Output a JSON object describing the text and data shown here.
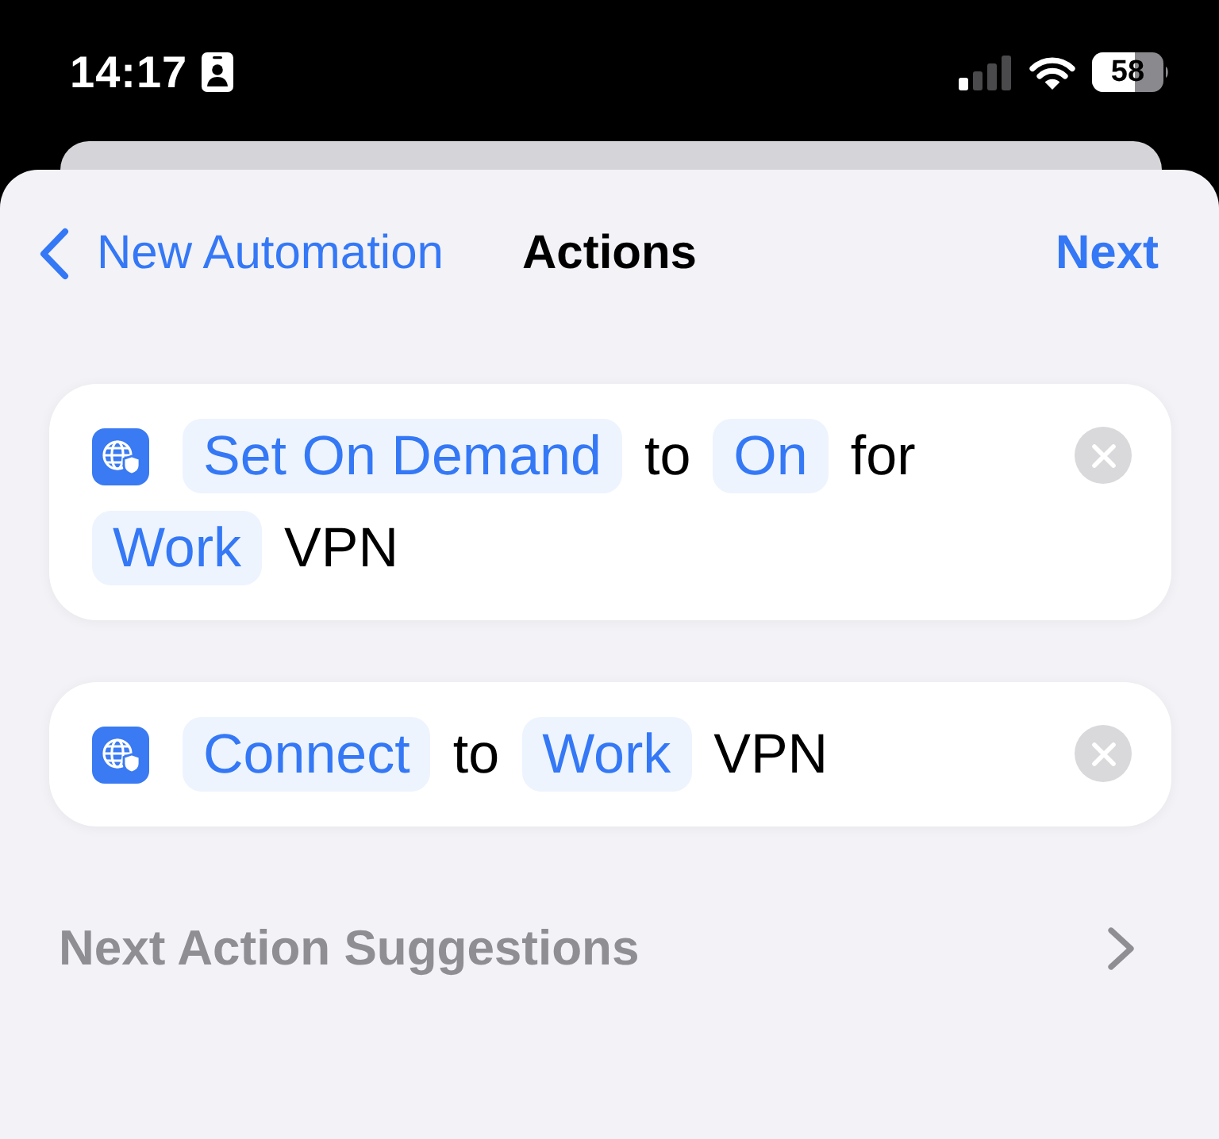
{
  "status_bar": {
    "time": "14:17",
    "battery": "58"
  },
  "nav": {
    "back": "New Automation",
    "title": "Actions",
    "action": "Next"
  },
  "actions": [
    {
      "parts": [
        {
          "kind": "token",
          "text": "Set On Demand"
        },
        {
          "kind": "word",
          "text": "to"
        },
        {
          "kind": "token",
          "text": "On"
        },
        {
          "kind": "word",
          "text": "for"
        },
        {
          "kind": "token",
          "text": "Work"
        },
        {
          "kind": "word",
          "text": "VPN"
        }
      ]
    },
    {
      "parts": [
        {
          "kind": "token",
          "text": "Connect"
        },
        {
          "kind": "word",
          "text": "to"
        },
        {
          "kind": "token",
          "text": "Work"
        },
        {
          "kind": "word",
          "text": "VPN"
        }
      ]
    }
  ],
  "suggestions": {
    "label": "Next Action Suggestions"
  }
}
